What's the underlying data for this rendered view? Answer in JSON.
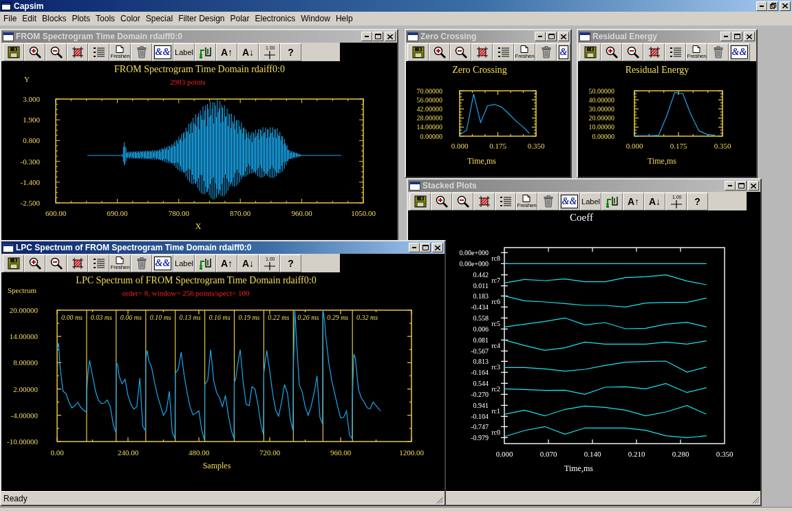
{
  "app": {
    "title": "Capsim"
  },
  "menu": [
    "File",
    "Edit",
    "Blocks",
    "Plots",
    "Tools",
    "Color",
    "Special",
    "Filter Design",
    "Polar",
    "Electronics",
    "Window",
    "Help"
  ],
  "windows": [
    {
      "kind": "waveform",
      "title": "FROM Spectrogram Time Domain rdaiff0:0",
      "active": false,
      "toolbar": [
        {
          "kind": "save"
        },
        {
          "kind": "zoom_in"
        },
        {
          "kind": "zoom_out"
        },
        {
          "kind": "hatch"
        },
        {
          "kind": "list"
        },
        {
          "kind": "freshen",
          "label": "Freshen"
        },
        {
          "kind": "delete"
        },
        {
          "kind": "font",
          "label": "&&"
        },
        {
          "kind": "label",
          "label": "Label"
        },
        {
          "kind": "swap"
        },
        {
          "kind": "font_up",
          "label": "A↑"
        },
        {
          "kind": "font_down",
          "label": "A↓"
        },
        {
          "kind": "grid",
          "label": "1.00"
        },
        {
          "kind": "help",
          "label": "?"
        }
      ],
      "plot": {
        "title": "FROM Spectrogram Time Domain rdaiff0:0",
        "subtitle": "2983 points",
        "ylabel": "Y",
        "xlabel": "X",
        "yticks": [
          "3.000",
          "1.900",
          "0.800",
          "-0.300",
          "-1.400",
          "-2.500"
        ],
        "xticks": [
          "600.00",
          "690.00",
          "780.00",
          "870.00",
          "960.00",
          "1050.00"
        ]
      }
    },
    {
      "kind": "line",
      "title": "Zero Crossing",
      "active": false,
      "toolbar": [
        {
          "kind": "save"
        },
        {
          "kind": "zoom_in"
        },
        {
          "kind": "zoom_out"
        },
        {
          "kind": "hatch"
        },
        {
          "kind": "list"
        },
        {
          "kind": "freshen",
          "label": "Freshen"
        },
        {
          "kind": "delete"
        },
        {
          "kind": "font",
          "label": "&"
        }
      ],
      "chart_data": {
        "type": "line",
        "title": "Zero Crossing",
        "xlabel": "Time,ms",
        "x": [
          0,
          0.032,
          0.064,
          0.096,
          0.128,
          0.16,
          0.192,
          0.224,
          0.256,
          0.288,
          0.32
        ],
        "series": [
          {
            "color": "#1ea6ec",
            "values": [
              2,
              9,
              65,
              21,
              47,
              49,
              45,
              35,
              24,
              15,
              4
            ]
          }
        ],
        "xlim": [
          0,
          0.35
        ],
        "ylim": [
          0,
          70
        ],
        "xticks": [
          {
            "value": 0,
            "label": "0.000"
          },
          {
            "value": 0.175,
            "label": "0.175"
          },
          {
            "value": 0.35,
            "label": "0.350"
          }
        ],
        "yticks": [
          {
            "value": 70,
            "label": "70.00000"
          },
          {
            "value": 56,
            "label": "56.00000"
          },
          {
            "value": 42,
            "label": "42.00000"
          },
          {
            "value": 28,
            "label": "28.00000"
          },
          {
            "value": 14,
            "label": "14.00000"
          },
          {
            "value": 0,
            "label": "0.00000"
          }
        ]
      }
    },
    {
      "kind": "line",
      "title": "Residual Energy",
      "active": false,
      "toolbar": [
        {
          "kind": "save"
        },
        {
          "kind": "zoom_in"
        },
        {
          "kind": "zoom_out"
        },
        {
          "kind": "hatch"
        },
        {
          "kind": "list"
        },
        {
          "kind": "freshen",
          "label": "Freshen"
        },
        {
          "kind": "delete"
        },
        {
          "kind": "font",
          "label": "&&"
        }
      ],
      "chart_data": {
        "type": "line",
        "title": "Residual Energy",
        "xlabel": "Time,ms",
        "x": [
          0,
          0.032,
          0.064,
          0.096,
          0.128,
          0.16,
          0.192,
          0.224,
          0.256,
          0.288,
          0.32
        ],
        "series": [
          {
            "color": "#1ea6ec",
            "values": [
              0.5,
              0.5,
              0.5,
              1,
              22,
              48,
              47,
              24,
              6,
              2,
              1
            ]
          }
        ],
        "xlim": [
          0,
          0.35
        ],
        "ylim": [
          0,
          50
        ],
        "xticks": [
          {
            "value": 0,
            "label": "0.000"
          },
          {
            "value": 0.175,
            "label": "0.175"
          },
          {
            "value": 0.35,
            "label": "0.350"
          }
        ],
        "yticks": [
          {
            "value": 50,
            "label": "50.00000"
          },
          {
            "value": 40,
            "label": "40.00000"
          },
          {
            "value": 30,
            "label": "30.00000"
          },
          {
            "value": 20,
            "label": "20.00000"
          },
          {
            "value": 10,
            "label": "10.00000"
          },
          {
            "value": 0,
            "label": "0.00000"
          }
        ]
      }
    },
    {
      "kind": "stacked",
      "title": "Stacked Plots",
      "active": false,
      "toolbar": [
        {
          "kind": "save"
        },
        {
          "kind": "zoom_in"
        },
        {
          "kind": "zoom_out"
        },
        {
          "kind": "hatch"
        },
        {
          "kind": "list"
        },
        {
          "kind": "freshen",
          "label": "Freshen"
        },
        {
          "kind": "delete"
        },
        {
          "kind": "font",
          "label": "&&"
        },
        {
          "kind": "label",
          "label": "Label"
        },
        {
          "kind": "swap"
        },
        {
          "kind": "font_up",
          "label": "A↑"
        },
        {
          "kind": "font_down",
          "label": "A↓"
        },
        {
          "kind": "grid",
          "label": "1.00"
        },
        {
          "kind": "help",
          "label": "?"
        }
      ],
      "plot": {
        "title": "Coeff",
        "xlabel": "Time,ms",
        "xticks": [
          "0.000",
          "0.070",
          "0.140",
          "0.210",
          "0.280",
          "0.350"
        ],
        "traces": [
          {
            "name": "rc8",
            "max": "0.00e+000",
            "min": "0.00e+000"
          },
          {
            "name": "rc7",
            "max": "0.442",
            "min": "0.011"
          },
          {
            "name": "rc6",
            "max": "0.183",
            "min": "-0.434"
          },
          {
            "name": "rc5",
            "max": "0.558",
            "min": "0.006"
          },
          {
            "name": "rc4",
            "max": "0.081",
            "min": "-0.567"
          },
          {
            "name": "rc3",
            "max": "0.813",
            "min": "-0.164"
          },
          {
            "name": "rc2",
            "max": "0.544",
            "min": "-0.270"
          },
          {
            "name": "rc1",
            "max": "0.941",
            "min": "-0.104"
          },
          {
            "name": "rc0",
            "max": "-0.747",
            "min": "-0.979"
          }
        ]
      }
    },
    {
      "kind": "spectrum",
      "title": "LPC Spectrum of FROM Spectrogram Time Domain rdaiff0:0",
      "active": true,
      "toolbar": [
        {
          "kind": "save"
        },
        {
          "kind": "zoom_in"
        },
        {
          "kind": "zoom_out"
        },
        {
          "kind": "hatch"
        },
        {
          "kind": "list"
        },
        {
          "kind": "freshen",
          "label": "Freshen"
        },
        {
          "kind": "delete"
        },
        {
          "kind": "font",
          "label": "&&"
        },
        {
          "kind": "label",
          "label": "Label"
        },
        {
          "kind": "swap"
        },
        {
          "kind": "font_up",
          "label": "A↑"
        },
        {
          "kind": "font_down",
          "label": "A↓"
        },
        {
          "kind": "grid",
          "label": "1.00"
        },
        {
          "kind": "help",
          "label": "?"
        }
      ],
      "subtitle": "order= 8, window= 256 points/spect= 100",
      "segments": [
        "0.00 ms",
        "0.03 ms",
        "0.06 ms",
        "0.10 ms",
        "0.13 ms",
        "0.16 ms",
        "0.19 ms",
        "0.22 ms",
        "0.26 ms",
        "0.29 ms",
        "0.32 ms"
      ],
      "chart_data": {
        "type": "line",
        "title": "LPC Spectrum of FROM Spectrogram Time Domain rdaiff0:0",
        "xlabel": "Samples",
        "ylabel": "Spectrum",
        "x": [
          0,
          5,
          10,
          20,
          30,
          40,
          50,
          60,
          70,
          80,
          90,
          99,
          100,
          105,
          110,
          120,
          130,
          140,
          150,
          160,
          170,
          180,
          190,
          199,
          200,
          205,
          210,
          220,
          230,
          240,
          250,
          260,
          270,
          280,
          290,
          299,
          300,
          305,
          310,
          320,
          330,
          340,
          350,
          360,
          370,
          380,
          390,
          399,
          400,
          405,
          410,
          420,
          430,
          440,
          450,
          460,
          470,
          480,
          490,
          499,
          500,
          505,
          510,
          520,
          530,
          540,
          550,
          560,
          570,
          580,
          590,
          599,
          600,
          605,
          610,
          620,
          630,
          640,
          650,
          660,
          670,
          680,
          690,
          699,
          700,
          705,
          710,
          720,
          730,
          740,
          750,
          760,
          770,
          780,
          790,
          799,
          800,
          805,
          810,
          820,
          830,
          840,
          850,
          860,
          870,
          880,
          890,
          899,
          900,
          905,
          910,
          920,
          930,
          940,
          950,
          960,
          970,
          980,
          990,
          999,
          1000,
          1005,
          1010,
          1020,
          1030,
          1040,
          1050,
          1060,
          1070,
          1080,
          1090,
          1096
        ],
        "series": [
          {
            "color": "#1aa7ec",
            "values": [
              11,
              12.5,
              7,
              1.5,
              1,
              -1,
              -2.3,
              -1.8,
              -1,
              -2.2,
              -2.8,
              -3.3,
              1,
              6,
              8.5,
              5,
              1.5,
              -0.6,
              -1.3,
              -1.2,
              -0.5,
              -2,
              -6,
              -8,
              8,
              7.5,
              5,
              3.2,
              4.2,
              0.5,
              -1.5,
              -2.6,
              -2,
              4.5,
              -6.5,
              -7.5,
              9,
              10.8,
              8.5,
              7,
              3.5,
              0.5,
              -1.8,
              -4,
              -3,
              1.5,
              -8,
              -9.3,
              5.6,
              6,
              6.5,
              10.4,
              5.3,
              1.3,
              -2,
              -3.9,
              -3.5,
              -3,
              -7.5,
              -9.7,
              3,
              3.5,
              4,
              11,
              4,
              1.2,
              0,
              -2,
              0.5,
              -4,
              -7.5,
              -9.3,
              3.6,
              4.3,
              7,
              11,
              3.5,
              -1.5,
              -1.8,
              2.5,
              2,
              -1.5,
              -6,
              -8.5,
              5.6,
              8.5,
              10.8,
              6,
              1,
              -2.8,
              -4.2,
              -1,
              3,
              1,
              -5,
              -7.5,
              6,
              20,
              14,
              3,
              1.3,
              -2,
              -4,
              -2,
              1,
              5,
              -4.5,
              -6,
              20,
              18,
              14,
              8,
              4,
              1,
              -2,
              -4.6,
              -4.5,
              -3,
              -8.5,
              -9.3,
              0,
              10,
              9,
              2,
              0,
              -1,
              -2.3,
              -2.5,
              -1,
              -1.8,
              -2.6,
              -3
            ]
          }
        ],
        "xlim": [
          0,
          1200
        ],
        "ylim": [
          -10,
          20
        ],
        "xticks": [
          {
            "value": 0,
            "label": "0.00"
          },
          {
            "value": 240,
            "label": "240.00"
          },
          {
            "value": 480,
            "label": "480.00"
          },
          {
            "value": 720,
            "label": "720.00"
          },
          {
            "value": 960,
            "label": "960.00"
          },
          {
            "value": 1200,
            "label": "1200.00"
          }
        ],
        "yticks": [
          {
            "value": 20,
            "label": "20.00000"
          },
          {
            "value": 14,
            "label": "14.00000"
          },
          {
            "value": 8,
            "label": "8.00000"
          },
          {
            "value": 2,
            "label": "2.00000"
          },
          {
            "value": -4,
            "label": "-4.00000"
          },
          {
            "value": -10,
            "label": "-10.00000"
          }
        ],
        "ref_lines": [
          {
            "axis": "x",
            "value": 100
          },
          {
            "axis": "x",
            "value": 200
          },
          {
            "axis": "x",
            "value": 300
          },
          {
            "axis": "x",
            "value": 400
          },
          {
            "axis": "x",
            "value": 500
          },
          {
            "axis": "x",
            "value": 600
          },
          {
            "axis": "x",
            "value": 700
          },
          {
            "axis": "x",
            "value": 800
          },
          {
            "axis": "x",
            "value": 900
          },
          {
            "axis": "x",
            "value": 1000
          }
        ]
      },
      "status_bar": {
        "text": "Ready"
      }
    }
  ]
}
